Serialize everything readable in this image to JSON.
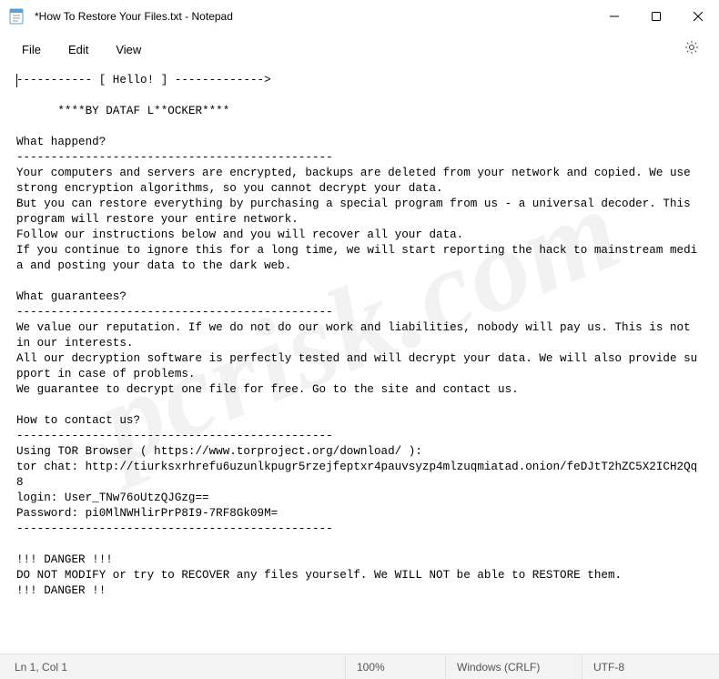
{
  "window": {
    "title": "*How To Restore Your Files.txt - Notepad"
  },
  "menu": {
    "file": "File",
    "edit": "Edit",
    "view": "View"
  },
  "editor": {
    "content": "----------- [ Hello! ] ------------->\n\n      ****BY DATAF L**OCKER****\n\nWhat happend?\n----------------------------------------------\nYour computers and servers are encrypted, backups are deleted from your network and copied. We use strong encryption algorithms, so you cannot decrypt your data.\nBut you can restore everything by purchasing a special program from us - a universal decoder. This program will restore your entire network.\nFollow our instructions below and you will recover all your data.\nIf you continue to ignore this for a long time, we will start reporting the hack to mainstream media and posting your data to the dark web.\n\nWhat guarantees?\n----------------------------------------------\nWe value our reputation. If we do not do our work and liabilities, nobody will pay us. This is not in our interests.\nAll our decryption software is perfectly tested and will decrypt your data. We will also provide support in case of problems.\nWe guarantee to decrypt one file for free. Go to the site and contact us.\n\nHow to contact us?\n----------------------------------------------\nUsing TOR Browser ( https://www.torproject.org/download/ ):\ntor chat: http://tiurksxrhrefu6uzunlkpugr5rzejfeptxr4pauvsyzp4mlzuqmiatad.onion/feDJtT2hZC5X2ICH2Qq8\nlogin: User_TNw76oUtzQJGzg==\nPassword: pi0MlNWHlirPrP8I9-7RF8Gk09M=\n----------------------------------------------\n\n!!! DANGER !!!\nDO NOT MODIFY or try to RECOVER any files yourself. We WILL NOT be able to RESTORE them.\n!!! DANGER !!"
  },
  "status": {
    "cursor": "Ln 1, Col 1",
    "zoom": "100%",
    "lineending": "Windows (CRLF)",
    "encoding": "UTF-8"
  },
  "watermark": "pcrisk.com"
}
